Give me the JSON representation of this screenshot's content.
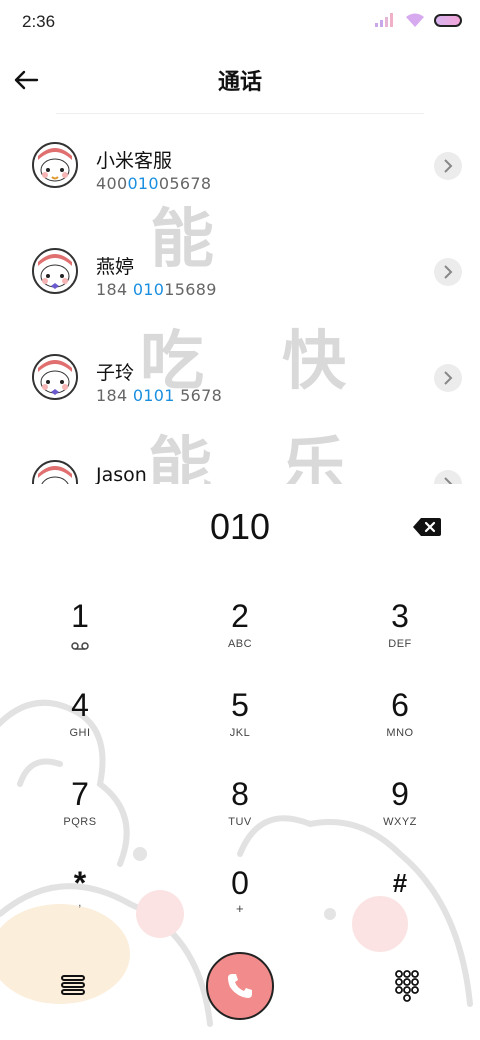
{
  "status_bar": {
    "time": "2:36"
  },
  "header": {
    "title": "通话"
  },
  "contacts": [
    {
      "name": "小米客服",
      "number_pre": "400",
      "number_hl": "010",
      "number_post": "05678"
    },
    {
      "name": "燕婷",
      "number_pre": "184 ",
      "number_hl": "010",
      "number_post": "15689"
    },
    {
      "name": "子玲",
      "number_pre": "184 ",
      "number_hl": "0101",
      "number_post": " 5678"
    },
    {
      "name": "Jason",
      "number_pre": "",
      "number_hl": "",
      "number_post": ""
    }
  ],
  "watermark": {
    "c1": "能",
    "c2": "吃",
    "c3": "快",
    "c4": "能",
    "c5": "乐"
  },
  "dialer": {
    "input": "010",
    "keys": [
      {
        "digit": "1",
        "letters": ""
      },
      {
        "digit": "2",
        "letters": "ABC"
      },
      {
        "digit": "3",
        "letters": "DEF"
      },
      {
        "digit": "4",
        "letters": "GHI"
      },
      {
        "digit": "5",
        "letters": "JKL"
      },
      {
        "digit": "6",
        "letters": "MNO"
      },
      {
        "digit": "7",
        "letters": "PQRS"
      },
      {
        "digit": "8",
        "letters": "TUV"
      },
      {
        "digit": "9",
        "letters": "WXYZ"
      },
      {
        "digit": "*",
        "letters": ","
      },
      {
        "digit": "0",
        "letters": "+"
      },
      {
        "digit": "#",
        "letters": ""
      }
    ]
  },
  "colors": {
    "highlight": "#1a8fe0",
    "call_button": "#f28b8b"
  },
  "icons": {
    "back": "arrow-left-icon",
    "chevron": "chevron-right-icon",
    "backspace": "backspace-icon",
    "voicemail": "voicemail-icon",
    "call": "phone-icon",
    "menu": "menu-icon",
    "keypad": "keypad-icon"
  }
}
